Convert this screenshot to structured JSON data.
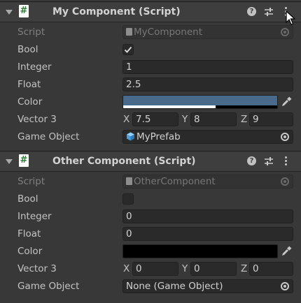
{
  "components": [
    {
      "title": "My Component (Script)",
      "script_icon_glyph": "#",
      "fields": {
        "script": {
          "label": "Script",
          "value": "MyComponent"
        },
        "bool": {
          "label": "Bool",
          "checked": true
        },
        "integer": {
          "label": "Integer",
          "value": "1"
        },
        "float": {
          "label": "Float",
          "value": "2.5"
        },
        "color": {
          "label": "Color",
          "value": "#4a6a8c",
          "alpha": 0.6
        },
        "vector3": {
          "label": "Vector 3",
          "x_label": "X",
          "x": "7.5",
          "y_label": "Y",
          "y": "8",
          "z_label": "Z",
          "z": "9"
        },
        "game_object": {
          "label": "Game Object",
          "value": "MyPrefab"
        }
      }
    },
    {
      "title": "Other Component (Script)",
      "script_icon_glyph": "#",
      "fields": {
        "script": {
          "label": "Script",
          "value": "OtherComponent"
        },
        "bool": {
          "label": "Bool",
          "checked": false
        },
        "integer": {
          "label": "Integer",
          "value": "0"
        },
        "float": {
          "label": "Float",
          "value": "0"
        },
        "color": {
          "label": "Color",
          "value": "#000000",
          "alpha": 0
        },
        "vector3": {
          "label": "Vector 3",
          "x_label": "X",
          "x": "0",
          "y_label": "Y",
          "y": "0",
          "z_label": "Z",
          "z": "0"
        },
        "game_object": {
          "label": "Game Object",
          "value": "None (Game Object)"
        }
      }
    }
  ],
  "icons": {
    "foldout": "triangle-down-icon",
    "script": "cs-script-icon",
    "help": "help-icon",
    "preset": "preset-sliders-icon",
    "menu": "kebab-menu-icon",
    "object_picker": "object-picker-icon",
    "eyedropper": "eyedropper-icon",
    "prefab": "prefab-cube-icon",
    "cursor": "mouse-cursor-icon"
  },
  "help_glyph": "?"
}
